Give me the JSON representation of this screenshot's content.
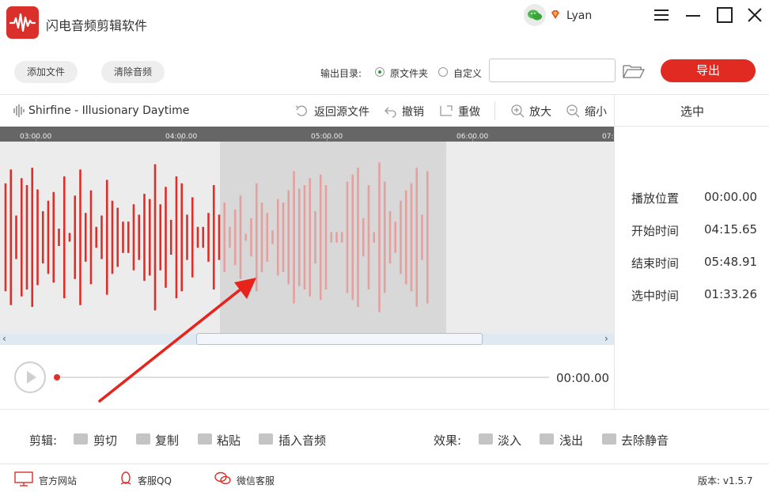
{
  "app": {
    "title": "闪电音频剪辑软件",
    "username": "Lyan"
  },
  "toolbar": {
    "add_file": "添加文件",
    "clear_audio": "清除音频",
    "output_dir_label": "输出目录:",
    "option_source": "原文件夹",
    "option_custom": "自定义",
    "selected_option": "原文件夹",
    "path_value": "",
    "export": "导出"
  },
  "editor": {
    "track_name": "Shirfine - Illusionary Daytime",
    "actions": {
      "revert": "返回源文件",
      "undo": "撤销",
      "redo": "重做",
      "zoom_in": "放大",
      "zoom_out": "缩小"
    },
    "timeline_ticks": [
      "03:00.00",
      "04:00.00",
      "05:00.00",
      "06:00.00",
      "07:"
    ],
    "waveform_color": "#d9302c",
    "selection_color": "#d8d8d8"
  },
  "panel": {
    "title": "选中",
    "rows": [
      {
        "label": "播放位置",
        "value": "00:00.00"
      },
      {
        "label": "开始时间",
        "value": "04:15.65"
      },
      {
        "label": "结束时间",
        "value": "05:48.91"
      },
      {
        "label": "选中时间",
        "value": "01:33.26"
      }
    ]
  },
  "player": {
    "time": "00:00.00",
    "progress": 0
  },
  "edit_tools": {
    "label": "剪辑:",
    "cut": "剪切",
    "copy": "复制",
    "paste": "粘贴",
    "insert": "插入音频"
  },
  "effect_tools": {
    "label": "效果:",
    "fade_in": "淡入",
    "fade_out": "浅出",
    "remove_silence": "去除静音"
  },
  "footer": {
    "website": "官方网站",
    "qq": "客服QQ",
    "wechat": "微信客服",
    "version": "版本: v1.5.7"
  },
  "colors": {
    "accent": "#e02a22",
    "timeline": "#666666",
    "annotation_arrow": "#e8231b"
  }
}
